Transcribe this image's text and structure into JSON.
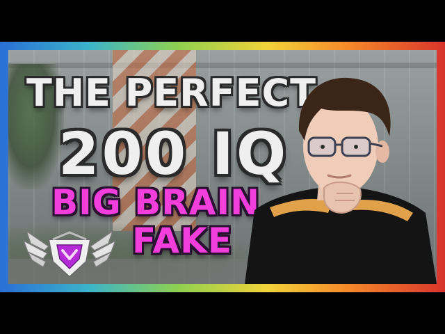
{
  "thumbnail": {
    "line1": "THE PERFECT",
    "line2": "200 IQ",
    "line3": "BIG BRAIN",
    "line4": "FAKE"
  },
  "colors": {
    "title_text": "#efefef",
    "accent_text": "#f23fdc",
    "outline": "#2a2a2a",
    "badge_core": "#b52bd6"
  },
  "icons": {
    "rank_badge": "winged-chevron-rank-badge"
  }
}
